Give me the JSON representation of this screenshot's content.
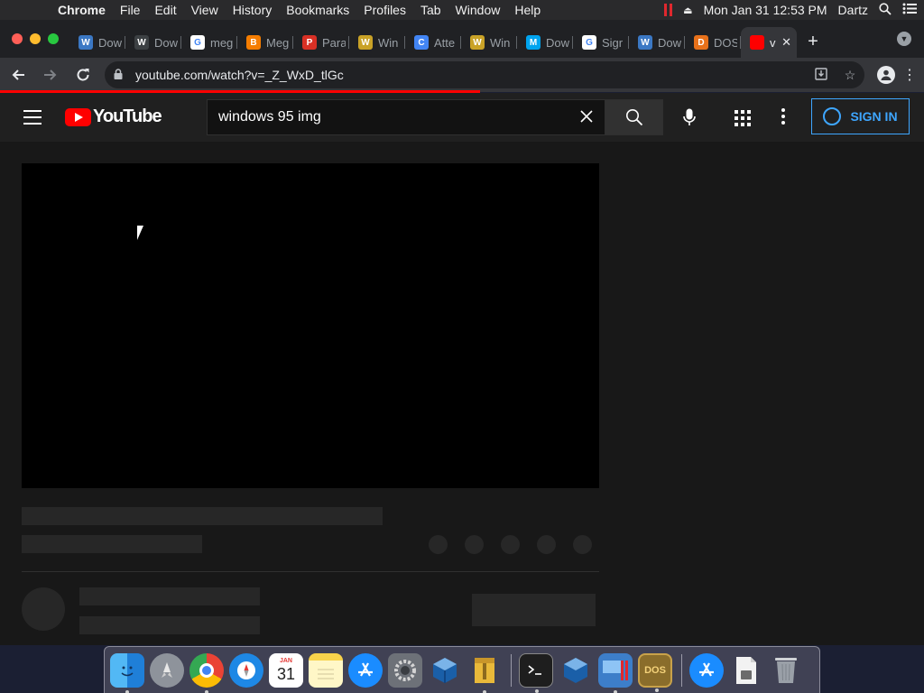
{
  "menubar": {
    "apple": "",
    "app_name": "Chrome",
    "items": [
      "File",
      "Edit",
      "View",
      "History",
      "Bookmarks",
      "Profiles",
      "Tab",
      "Window",
      "Help"
    ],
    "clock": "Mon Jan 31  12:53 PM",
    "user": "Dartz"
  },
  "tabs": [
    {
      "label": "Dow",
      "fav_color": "#3b78c4",
      "fav_char": "W"
    },
    {
      "label": "Dow",
      "fav_color": "#3c4043",
      "fav_char": "W"
    },
    {
      "label": "meg",
      "fav_color": "#ffffff",
      "fav_char": "G"
    },
    {
      "label": "Meg",
      "fav_color": "#f57d00",
      "fav_char": "B"
    },
    {
      "label": "Para",
      "fav_color": "#d93025",
      "fav_char": "P"
    },
    {
      "label": "Win",
      "fav_color": "#c9a227",
      "fav_char": "W"
    },
    {
      "label": "Atte",
      "fav_color": "#4285f4",
      "fav_char": "C"
    },
    {
      "label": "Win",
      "fav_color": "#c9a227",
      "fav_char": "W"
    },
    {
      "label": "Dow",
      "fav_color": "#00a4ef",
      "fav_char": "M"
    },
    {
      "label": "Sigr",
      "fav_color": "#ffffff",
      "fav_char": "G"
    },
    {
      "label": "Dow",
      "fav_color": "#3b78c4",
      "fav_char": "W"
    },
    {
      "label": "DOS",
      "fav_color": "#e8711a",
      "fav_char": "D"
    }
  ],
  "active_tab": {
    "label": "v",
    "fav_color": "#ff0000"
  },
  "toolbar": {
    "url": "youtube.com/watch?v=_Z_WxD_tlGc",
    "load_progress": 0.52
  },
  "youtube": {
    "logo_text": "YouTube",
    "search_value": "windows 95 img",
    "signin_label": "SIGN IN"
  },
  "colors": {
    "youtube_red": "#ff0000",
    "signin_blue": "#3ea6ff",
    "skeleton": "#272727",
    "page_bg": "#181818"
  },
  "dock": {
    "items": [
      "finder-icon",
      "launchpad-icon",
      "chrome-icon",
      "safari-icon",
      "calendar-icon",
      "notes-icon",
      "app-store-icon",
      "system-preferences-icon",
      "virtualbox-icon",
      "archive-utility-icon",
      "terminal-icon",
      "virtualbox-icon",
      "windows-vm-icon",
      "dosbox-icon",
      "app-store-downloads-icon",
      "document-icon",
      "trash-icon"
    ],
    "calendar": {
      "month": "JAN",
      "day": "31"
    },
    "dosbox_label": "DOS"
  }
}
